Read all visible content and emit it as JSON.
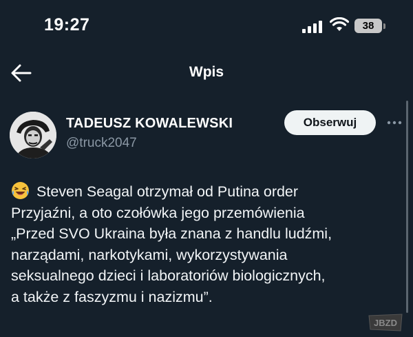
{
  "status_bar": {
    "time": "19:27",
    "battery_level": "38"
  },
  "nav": {
    "title": "Wpis"
  },
  "author": {
    "name": "TADEUSZ KOWALEWSKI",
    "handle": "@truck2047"
  },
  "follow_label": "Obserwuj",
  "tweet": {
    "lines": [
      "Steven Seagal otrzymał od Putina order",
      "Przyjaźni, a oto czołówka jego przemówienia",
      "„Przed SVO Ukraina była znana z handlu ludźmi,",
      "narządami, narkotykami, wykorzystywania",
      "seksualnego dzieci i laboratoriów biologicznych,",
      "a także z faszyzmu i nazizmu”."
    ]
  },
  "watermark_text": "JBZD",
  "icons": [
    "signal-icon",
    "wifi-icon",
    "battery-icon",
    "back-arrow-icon",
    "more-icon",
    "laughing-emoji-icon"
  ],
  "colors": {
    "background": "#15202b",
    "text": "#ffffff",
    "secondary": "#8b98a5",
    "button_bg": "#eff3f4"
  }
}
